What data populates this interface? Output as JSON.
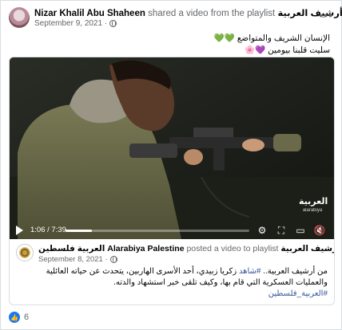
{
  "post": {
    "author": "Nizar Khalil Abu Shaheen",
    "action": " shared a video from the playlist ",
    "playlist": "أرشيف العربية.",
    "date": "September 9, 2021 ·",
    "caption_line1": "الإنسان الشريف والمتواضع 💚💚",
    "caption_line2": "سليت قلبنا بيومين 💜🌸",
    "more_icon": "more-options-icon"
  },
  "video": {
    "time": "1:06 / 7:39",
    "progress_fraction": 0.144,
    "channel_logo": "العربية",
    "channel_logo_latin": "alarabiya"
  },
  "shared": {
    "author": "العربية فلسطين Alarabiya Palestine",
    "action": " posted a video to playlist ",
    "playlist": "أرشيف العربية.",
    "date": "September 8, 2021 ·",
    "text_prefix": "من أرشيف العربية.. ",
    "hashtag1": "#شاهد",
    "text_body": " زكريا زبيدي، أحد الأسرى الهاربين، يتحدث عن حياته العائلية والعمليات العسكرية التي قام بها، وكيف تلقى خبر استشهاد والدته.",
    "hashtag2": "#العربية_فلسطين"
  },
  "footer": {
    "reaction_count": "6"
  },
  "colors": {
    "link": "#385898",
    "like": "#1877f2",
    "secondary": "#65676b"
  }
}
